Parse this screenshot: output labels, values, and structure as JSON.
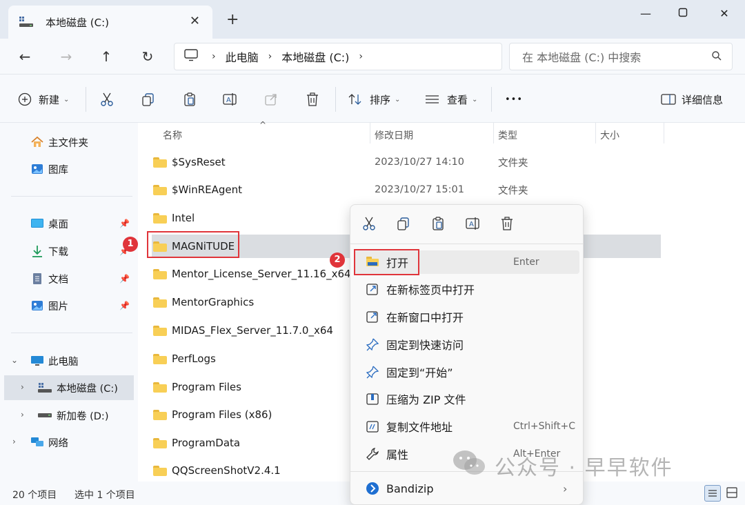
{
  "window": {
    "tab_title": "本地磁盘 (C:)",
    "new_tab": "+",
    "close_tab": "✕"
  },
  "address": {
    "crumbs": [
      "此电脑",
      "本地磁盘 (C:)"
    ],
    "search_placeholder": "在 本地磁盘 (C:) 中搜索"
  },
  "toolbar": {
    "new_label": "新建",
    "sort_label": "排序",
    "view_label": "查看",
    "more": "•••",
    "details_label": "详细信息"
  },
  "sidebar": {
    "items": [
      {
        "label": "主文件夹",
        "icon": "home-icon"
      },
      {
        "label": "图库",
        "icon": "gallery-icon"
      },
      {
        "label": "桌面",
        "icon": "desktop-icon",
        "pinned": true
      },
      {
        "label": "下载",
        "icon": "download-icon",
        "pinned": true
      },
      {
        "label": "文档",
        "icon": "document-icon",
        "pinned": true
      },
      {
        "label": "图片",
        "icon": "pictures-icon",
        "pinned": true
      },
      {
        "label": "此电脑",
        "icon": "pc-icon"
      },
      {
        "label": "本地磁盘 (C:)",
        "icon": "drive-icon",
        "selected": true
      },
      {
        "label": "新加卷 (D:)",
        "icon": "drive-icon"
      },
      {
        "label": "网络",
        "icon": "network-icon"
      }
    ]
  },
  "columns": {
    "name": "名称",
    "modified": "修改日期",
    "type": "类型",
    "size": "大小"
  },
  "files": [
    {
      "name": "$SysReset",
      "modified": "2023/10/27 14:10",
      "type": "文件夹"
    },
    {
      "name": "$WinREAgent",
      "modified": "2023/10/27 15:01",
      "type": "文件夹"
    },
    {
      "name": "Intel",
      "modified": "",
      "type": ""
    },
    {
      "name": "MAGNiTUDE",
      "modified": "",
      "type": "",
      "selected": true
    },
    {
      "name": "Mentor_License_Server_11.16_x64",
      "modified": "",
      "type": ""
    },
    {
      "name": "MentorGraphics",
      "modified": "",
      "type": ""
    },
    {
      "name": "MIDAS_Flex_Server_11.7.0_x64",
      "modified": "",
      "type": ""
    },
    {
      "name": "PerfLogs",
      "modified": "",
      "type": ""
    },
    {
      "name": "Program Files",
      "modified": "",
      "type": ""
    },
    {
      "name": "Program Files (x86)",
      "modified": "",
      "type": ""
    },
    {
      "name": "ProgramData",
      "modified": "",
      "type": ""
    },
    {
      "name": "QQScreenShotV2.4.1",
      "modified": "",
      "type": ""
    }
  ],
  "context_menu": {
    "quick_actions": [
      "cut-icon",
      "copy-icon",
      "paste-icon",
      "rename-icon",
      "delete-icon"
    ],
    "items": [
      {
        "label": "打开",
        "shortcut": "Enter",
        "icon": "folder-open-icon",
        "highlighted": true
      },
      {
        "label": "在新标签页中打开",
        "shortcut": "",
        "icon": "new-tab-icon"
      },
      {
        "label": "在新窗口中打开",
        "shortcut": "",
        "icon": "new-window-icon"
      },
      {
        "label": "固定到快速访问",
        "shortcut": "",
        "icon": "pin-icon"
      },
      {
        "label": "固定到“开始”",
        "shortcut": "",
        "icon": "pin-icon"
      },
      {
        "label": "压缩为 ZIP 文件",
        "shortcut": "",
        "icon": "zip-icon"
      },
      {
        "label": "复制文件地址",
        "shortcut": "Ctrl+Shift+C",
        "icon": "copy-path-icon"
      },
      {
        "label": "属性",
        "shortcut": "Alt+Enter",
        "icon": "wrench-icon"
      }
    ],
    "bandizip": "Bandizip"
  },
  "status": {
    "count": "20 个项目",
    "selected": "选中 1 个项目"
  },
  "annotations": {
    "badge1": "1",
    "badge2": "2"
  },
  "watermark": "公众号 · 早早软件"
}
